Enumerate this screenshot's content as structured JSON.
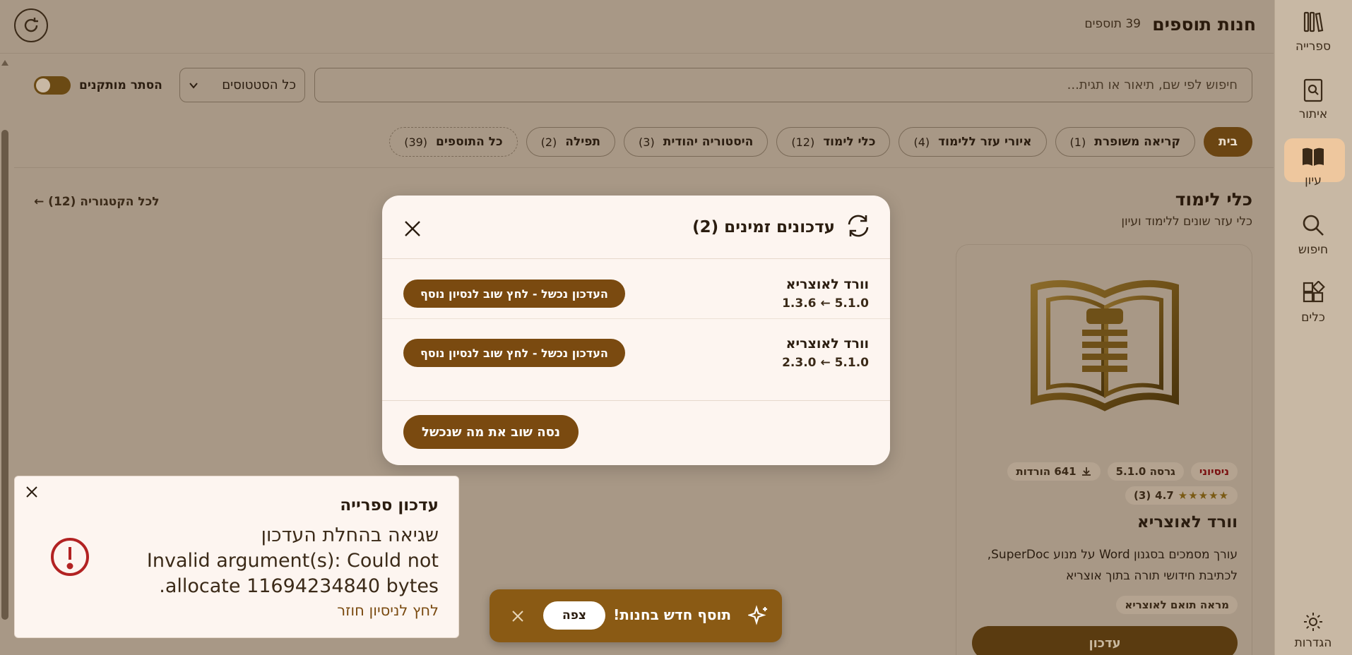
{
  "header": {
    "title": "חנות תוספים",
    "count": "39 תוספים"
  },
  "nav": {
    "items": [
      {
        "label": "ספרייה",
        "icon": "books-icon"
      },
      {
        "label": "איתור",
        "icon": "locate-book-icon"
      },
      {
        "label": "עיון",
        "icon": "open-book-icon"
      },
      {
        "label": "חיפוש",
        "icon": "search-icon"
      },
      {
        "label": "כלים",
        "icon": "tools-icon"
      }
    ],
    "active": "עיון",
    "settings_label": "הגדרות"
  },
  "filters": {
    "search_placeholder": "חיפוש לפי שם, תיאור או תגית...",
    "status_select": "כל הסטטוסים",
    "hide_installed": "הסתר מותקנים"
  },
  "tabs": [
    {
      "label": "בית",
      "count": ""
    },
    {
      "label": "קריאה משופרת",
      "count": "(1)"
    },
    {
      "label": "איורי עזר ללימוד",
      "count": "(4)"
    },
    {
      "label": "כלי לימוד",
      "count": "(12)"
    },
    {
      "label": "היסטוריה יהודית",
      "count": "(3)"
    },
    {
      "label": "תפילה",
      "count": "(2)"
    },
    {
      "label": "כל התוספים",
      "count": "(39)"
    }
  ],
  "category": {
    "title": "כלי לימוד",
    "subtitle": "כלי עזר שונים ללימוד ועיון",
    "all_link": "לכל הקטגוריה (12) ←"
  },
  "card": {
    "badge_experimental": "ניסיוני",
    "version": "גרסה 5.1.0",
    "downloads": "641 הורדות",
    "rating": "4.7",
    "rating_count": "(3)",
    "stars": 5,
    "name": "וורד לאוצריא",
    "description": "עורך מסמכים בסגנון Word על מנוע SuperDoc, לכתיבת חידושי תורה בתוך אוצריא",
    "tag": "מראה תואם לאוצריא",
    "button": "עדכון"
  },
  "modal": {
    "title": "עדכונים זמינים (2)",
    "rows": [
      {
        "name": "וורד לאוצריא",
        "version": "5.1.0 ← 1.3.6",
        "status": "העדכון נכשל - לחץ שוב לנסיון נוסף"
      },
      {
        "name": "וורד לאוצריא",
        "version": "5.1.0 ← 2.3.0",
        "status": "העדכון נכשל - לחץ שוב לנסיון נוסף"
      }
    ],
    "retry": "נסה שוב את מה שנכשל"
  },
  "error_toast": {
    "title": "עדכון ספרייה",
    "message_line1": "שגיאה בהחלת העדכון",
    "message_line2": "Invalid argument(s): Could not allocate 11694234840 bytes.",
    "link": "לחץ לניסיון חוזר"
  },
  "new_toast": {
    "text": "תוסף חדש בחנות!",
    "button": "צפה"
  },
  "colors": {
    "accent": "#7a4a10",
    "active_tab": "#6b4512",
    "error": "#b22222"
  }
}
